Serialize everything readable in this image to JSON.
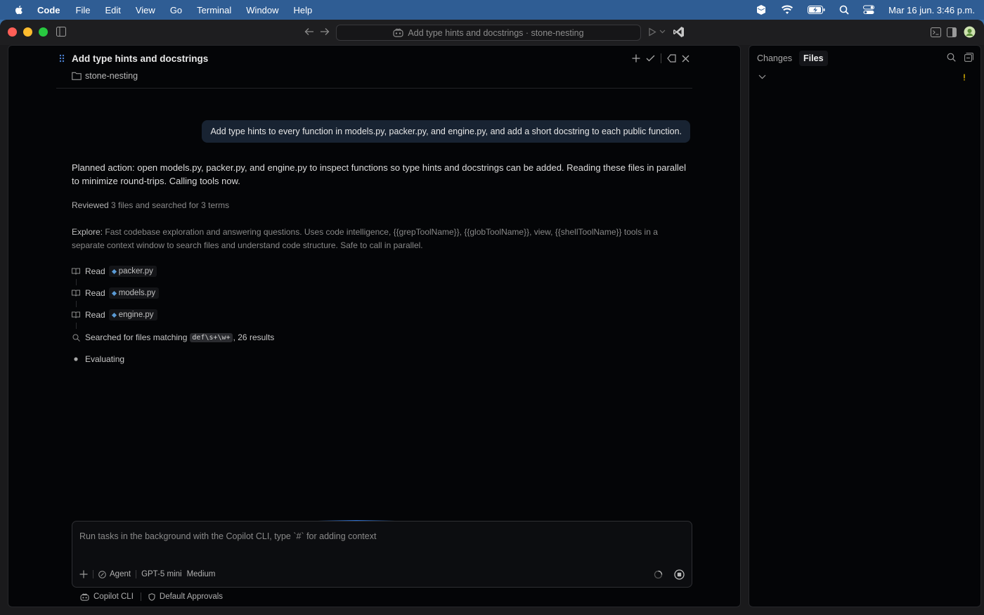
{
  "menubar": {
    "app": "Code",
    "items": [
      "File",
      "Edit",
      "View",
      "Go",
      "Terminal",
      "Window",
      "Help"
    ],
    "clock": "Mar 16 jun.  3:46 p.m."
  },
  "titlebar": {
    "command_center": "Add type hints and docstrings · stone-nesting"
  },
  "session": {
    "title": "Add type hints and docstrings",
    "folder": "stone-nesting"
  },
  "chat": {
    "user_message": "Add type hints to every function in models.py, packer.py, and engine.py, and add a short docstring to each public function.",
    "response": "Planned action: open models.py, packer.py, and engine.py to inspect functions so type hints and docstrings can be added. Reading these files in parallel to minimize round-trips. Calling tools now.",
    "reviewed_label": "Reviewed",
    "reviewed_text": "3 files and searched for 3 terms",
    "explore_label": "Explore:",
    "explore_text": "Fast codebase exploration and answering questions. Uses code intelligence, {{grepToolName}}, {{globToolName}}, view, {{shellToolName}} tools in a separate context window to search files and understand code structure. Safe to call in parallel.",
    "steps": [
      {
        "verb": "Read",
        "file": "packer.py"
      },
      {
        "verb": "Read",
        "file": "models.py"
      },
      {
        "verb": "Read",
        "file": "engine.py"
      }
    ],
    "search_prefix": "Searched for files matching",
    "search_pattern": "def\\s+\\w+",
    "search_suffix": ", 26 results",
    "status": "Evaluating"
  },
  "composer": {
    "placeholder": "Run tasks in the background with the Copilot CLI, type `#` for adding context",
    "agent": "Agent",
    "model": "GPT-5 mini",
    "effort": "Medium"
  },
  "footer": {
    "cli": "Copilot CLI",
    "approvals": "Default Approvals"
  },
  "side": {
    "tabs": [
      "Changes",
      "Files"
    ],
    "active_tab": "Files"
  },
  "colors": {
    "accent": "#2d6fd0",
    "user_bubble": "#182332",
    "panel_bg": "#040507"
  }
}
